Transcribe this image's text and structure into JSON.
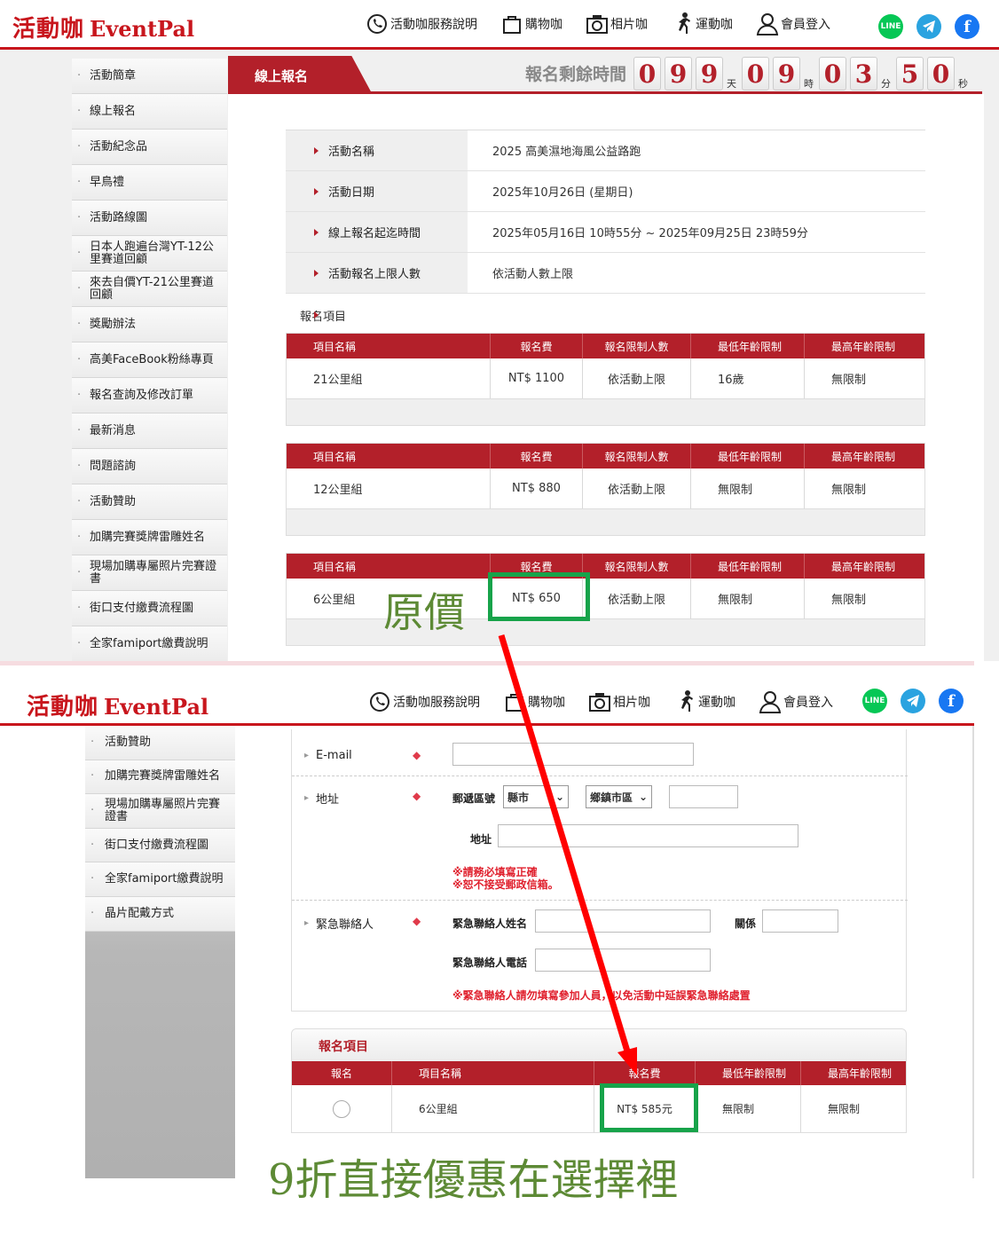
{
  "header": {
    "logo_cn": "活動咖",
    "logo_en": "EventPal",
    "nav": [
      {
        "label": "活動咖服務說明",
        "icon": "phone-icon"
      },
      {
        "label": "購物咖",
        "icon": "shopping-bag-icon"
      },
      {
        "label": "相片咖",
        "icon": "camera-icon"
      },
      {
        "label": "運動咖",
        "icon": "runner-icon"
      },
      {
        "label": "會員登入",
        "icon": "user-icon"
      }
    ],
    "social": [
      {
        "label": "LINE",
        "icon": "line-icon",
        "color": "#06c755"
      },
      {
        "label": "",
        "icon": "telegram-icon",
        "color": "#2aa3e0"
      },
      {
        "label": "f",
        "icon": "facebook-icon",
        "color": "#1877f2"
      }
    ]
  },
  "sidebar1": [
    "活動簡章",
    "線上報名",
    "活動紀念品",
    "早鳥禮",
    "活動路線圖",
    "日本人跑遍台灣YT-12公里賽道回顧",
    "來去自價YT-21公里賽道回顧",
    "獎勵辦法",
    "高美FaceBook粉絲專頁",
    "報名查詢及修改訂單",
    "最新消息",
    "問題諮詢",
    "活動贊助",
    "加購完賽獎牌雷雕姓名",
    "現場加購專屬照片完賽證書",
    "街口支付繳費流程圖",
    "全家famiport繳費說明"
  ],
  "tab_title": "線上報名",
  "countdown": {
    "title": "報名剩餘時間",
    "days": [
      "0",
      "9",
      "9"
    ],
    "hours": [
      "0",
      "9"
    ],
    "minutes": [
      "0",
      "3"
    ],
    "seconds": [
      "5",
      "0"
    ],
    "unit_day": "天",
    "unit_hour": "時",
    "unit_min": "分",
    "unit_sec": "秒"
  },
  "event_info": [
    {
      "label": "活動名稱",
      "value": "2025 高美濕地海風公益路跑"
    },
    {
      "label": "活動日期",
      "value": "2025年10月26日 (星期日)"
    },
    {
      "label": "線上報名起迄時間",
      "value": "2025年05月16日 10時55分 ~ 2025年09月25日 23時59分"
    },
    {
      "label": "活動報名上限人數",
      "value": "依活動人數上限"
    }
  ],
  "reg_items_label": "報名項目",
  "item_headers": [
    "項目名稱",
    "報名費",
    "報名限制人數",
    "最低年齡限制",
    "最高年齡限制"
  ],
  "items": [
    [
      "21公里組",
      "NT$ 1100",
      "依活動上限",
      "16歲",
      "無限制"
    ],
    [
      "12公里組",
      "NT$ 880",
      "依活動上限",
      "無限制",
      "無限制"
    ],
    [
      "6公里組",
      "NT$ 650",
      "依活動上限",
      "無限制",
      "無限制"
    ]
  ],
  "annotation_original": "原價",
  "sidebar2": [
    "活動贊助",
    "加購完賽獎牌雷雕姓名",
    "現場加購專屬照片完賽證書",
    "街口支付繳費流程圖",
    "全家famiport繳費說明",
    "晶片配戴方式"
  ],
  "form": {
    "email_label": "E-mail",
    "address_label": "地址",
    "zip_label": "郵遞區號",
    "county_value": "縣市",
    "district_value": "鄉鎮市區",
    "address_sub_label": "地址",
    "address_note1": "※請務必填寫正確",
    "address_note2": "※恕不接受郵政信箱。",
    "emergency_label": "緊急聯絡人",
    "emergency_name_label": "緊急聯絡人姓名",
    "relation_label": "關係",
    "emergency_phone_label": "緊急聯絡人電話",
    "emergency_note": "※緊急聯絡人請勿填寫參加人員，以免活動中延誤緊急聯絡處置"
  },
  "reg_box": {
    "title": "報名項目",
    "headers": [
      "報名",
      "項目名稱",
      "報名費",
      "最低年齡限制",
      "最高年齡限制"
    ],
    "row": [
      "6公里組",
      "NT$ 585元",
      "無限制",
      "無限制"
    ]
  },
  "annotation_discount": "9折直接優惠在選擇裡",
  "colors": {
    "brand_red": "#c8161d",
    "table_red": "#b3202a",
    "highlight_green": "#17a34a",
    "arrow_red": "#ff0000",
    "annotation_green": "#5d8a35"
  }
}
